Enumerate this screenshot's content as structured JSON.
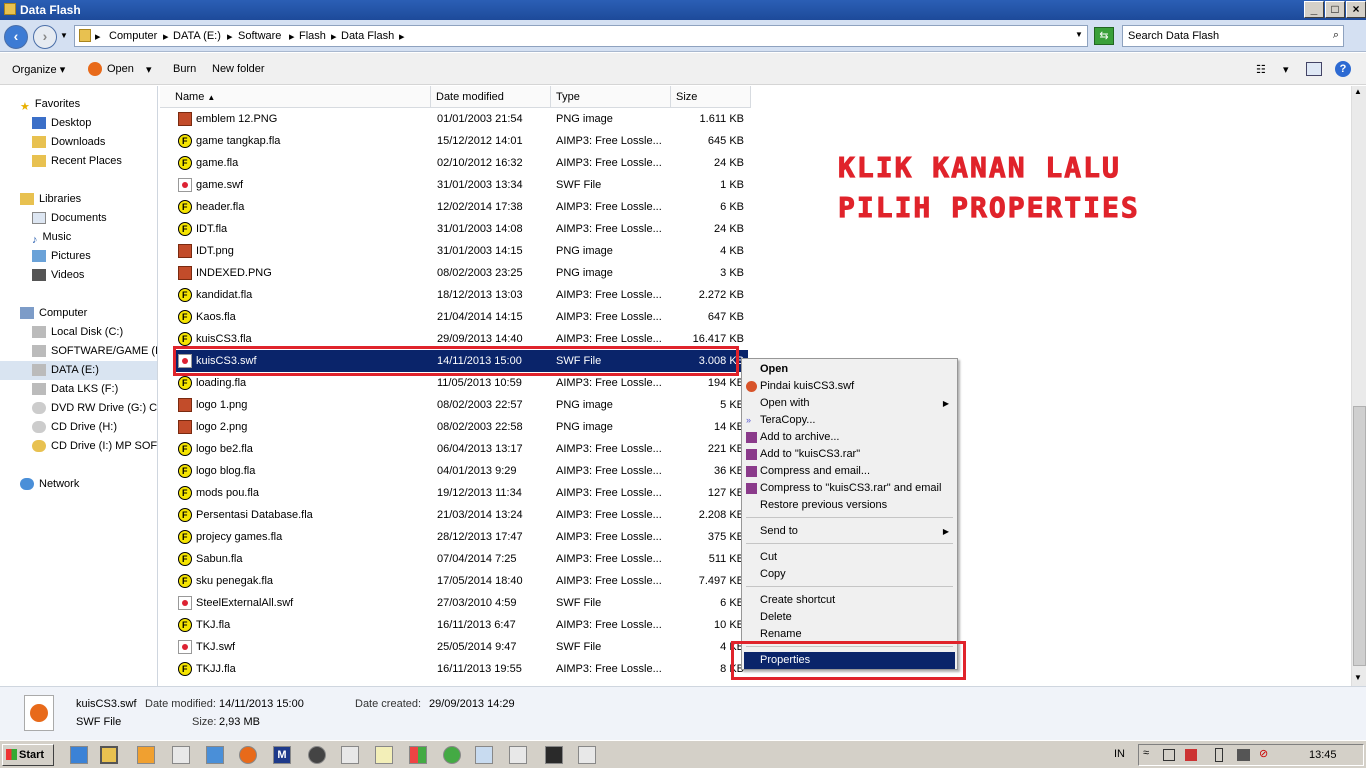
{
  "window": {
    "title": "Data Flash"
  },
  "address": {
    "crumbs": [
      "Computer",
      "DATA (E:)",
      "Software",
      "Flash",
      "Data Flash"
    ],
    "search_placeholder": "Search Data Flash"
  },
  "toolbar": {
    "organize": "Organize",
    "open": "Open",
    "burn": "Burn",
    "new_folder": "New folder"
  },
  "nav": {
    "favorites": "Favorites",
    "fav_items": [
      "Desktop",
      "Downloads",
      "Recent Places"
    ],
    "libraries": "Libraries",
    "lib_items": [
      "Documents",
      "Music",
      "Pictures",
      "Videos"
    ],
    "computer": "Computer",
    "drives": [
      "Local Disk (C:)",
      "SOFTWARE/GAME (D:",
      "DATA (E:)",
      "Data LKS (F:)",
      "DVD RW Drive (G:) CD",
      "CD Drive (H:)",
      "CD Drive (I:) MP SOFT"
    ],
    "network": "Network"
  },
  "columns": {
    "name": "Name",
    "date": "Date modified",
    "type": "Type",
    "size": "Size"
  },
  "files": [
    {
      "name": "emblem 12.PNG",
      "date": "01/01/2003 21:54",
      "type": "PNG image",
      "size": "1.611 KB",
      "kind": "png"
    },
    {
      "name": "game tangkap.fla",
      "date": "15/12/2012 14:01",
      "type": "AIMP3: Free Lossle...",
      "size": "645 KB",
      "kind": "fla"
    },
    {
      "name": "game.fla",
      "date": "02/10/2012 16:32",
      "type": "AIMP3: Free Lossle...",
      "size": "24 KB",
      "kind": "fla"
    },
    {
      "name": "game.swf",
      "date": "31/01/2003 13:34",
      "type": "SWF File",
      "size": "1 KB",
      "kind": "swf"
    },
    {
      "name": "header.fla",
      "date": "12/02/2014 17:38",
      "type": "AIMP3: Free Lossle...",
      "size": "6 KB",
      "kind": "fla"
    },
    {
      "name": "IDT.fla",
      "date": "31/01/2003 14:08",
      "type": "AIMP3: Free Lossle...",
      "size": "24 KB",
      "kind": "fla"
    },
    {
      "name": "IDT.png",
      "date": "31/01/2003 14:15",
      "type": "PNG image",
      "size": "4 KB",
      "kind": "png"
    },
    {
      "name": "INDEXED.PNG",
      "date": "08/02/2003 23:25",
      "type": "PNG image",
      "size": "3 KB",
      "kind": "png"
    },
    {
      "name": "kandidat.fla",
      "date": "18/12/2013 13:03",
      "type": "AIMP3: Free Lossle...",
      "size": "2.272 KB",
      "kind": "fla"
    },
    {
      "name": "Kaos.fla",
      "date": "21/04/2014 14:15",
      "type": "AIMP3: Free Lossle...",
      "size": "647 KB",
      "kind": "fla"
    },
    {
      "name": "kuisCS3.fla",
      "date": "29/09/2013 14:40",
      "type": "AIMP3: Free Lossle...",
      "size": "16.417 KB",
      "kind": "fla"
    },
    {
      "name": "kuisCS3.swf",
      "date": "14/11/2013 15:00",
      "type": "SWF File",
      "size": "3.008 KB",
      "kind": "swf",
      "selected": true
    },
    {
      "name": "loading.fla",
      "date": "11/05/2013 10:59",
      "type": "AIMP3: Free Lossle...",
      "size": "194 KB",
      "kind": "fla"
    },
    {
      "name": "logo 1.png",
      "date": "08/02/2003 22:57",
      "type": "PNG image",
      "size": "5 KB",
      "kind": "png"
    },
    {
      "name": "logo 2.png",
      "date": "08/02/2003 22:58",
      "type": "PNG image",
      "size": "14 KB",
      "kind": "png"
    },
    {
      "name": "logo be2.fla",
      "date": "06/04/2013 13:17",
      "type": "AIMP3: Free Lossle...",
      "size": "221 KB",
      "kind": "fla"
    },
    {
      "name": "logo blog.fla",
      "date": "04/01/2013 9:29",
      "type": "AIMP3: Free Lossle...",
      "size": "36 KB",
      "kind": "fla"
    },
    {
      "name": "mods pou.fla",
      "date": "19/12/2013 11:34",
      "type": "AIMP3: Free Lossle...",
      "size": "127 KB",
      "kind": "fla"
    },
    {
      "name": "Persentasi Database.fla",
      "date": "21/03/2014 13:24",
      "type": "AIMP3: Free Lossle...",
      "size": "2.208 KB",
      "kind": "fla"
    },
    {
      "name": "projecy games.fla",
      "date": "28/12/2013 17:47",
      "type": "AIMP3: Free Lossle...",
      "size": "375 KB",
      "kind": "fla"
    },
    {
      "name": "Sabun.fla",
      "date": "07/04/2014 7:25",
      "type": "AIMP3: Free Lossle...",
      "size": "511 KB",
      "kind": "fla"
    },
    {
      "name": "sku penegak.fla",
      "date": "17/05/2014 18:40",
      "type": "AIMP3: Free Lossle...",
      "size": "7.497 KB",
      "kind": "fla"
    },
    {
      "name": "SteelExternalAll.swf",
      "date": "27/03/2010 4:59",
      "type": "SWF File",
      "size": "6 KB",
      "kind": "swf"
    },
    {
      "name": "TKJ.fla",
      "date": "16/11/2013 6:47",
      "type": "AIMP3: Free Lossle...",
      "size": "10 KB",
      "kind": "fla"
    },
    {
      "name": "TKJ.swf",
      "date": "25/05/2014 9:47",
      "type": "SWF File",
      "size": "4 KB",
      "kind": "swf"
    },
    {
      "name": "TKJJ.fla",
      "date": "16/11/2013 19:55",
      "type": "AIMP3: Free Lossle...",
      "size": "8 KB",
      "kind": "fla"
    }
  ],
  "context_menu": {
    "open": "Open",
    "pindai": "Pindai kuisCS3.swf",
    "open_with": "Open with",
    "teracopy": "TeraCopy...",
    "add_archive": "Add to archive...",
    "add_rar": "Add to \"kuisCS3.rar\"",
    "compress_email": "Compress and email...",
    "compress_rar_email": "Compress to \"kuisCS3.rar\" and email",
    "restore": "Restore previous versions",
    "send_to": "Send to",
    "cut": "Cut",
    "copy": "Copy",
    "create_shortcut": "Create shortcut",
    "delete": "Delete",
    "rename": "Rename",
    "properties": "Properties"
  },
  "annotation": {
    "line1": "KLIK KANAN LALU",
    "line2": "PILIH PROPERTIES"
  },
  "details": {
    "filename": "kuisCS3.swf",
    "modified_label": "Date modified:",
    "modified_value": "14/11/2013 15:00",
    "created_label": "Date created:",
    "created_value": "29/09/2013 14:29",
    "type": "SWF File",
    "size_label": "Size:",
    "size_value": "2,93 MB"
  },
  "taskbar": {
    "start": "Start",
    "lang": "IN",
    "clock": "13:45"
  },
  "colors": {
    "selection": "#0a246a",
    "annotation_red": "#e0232b"
  }
}
